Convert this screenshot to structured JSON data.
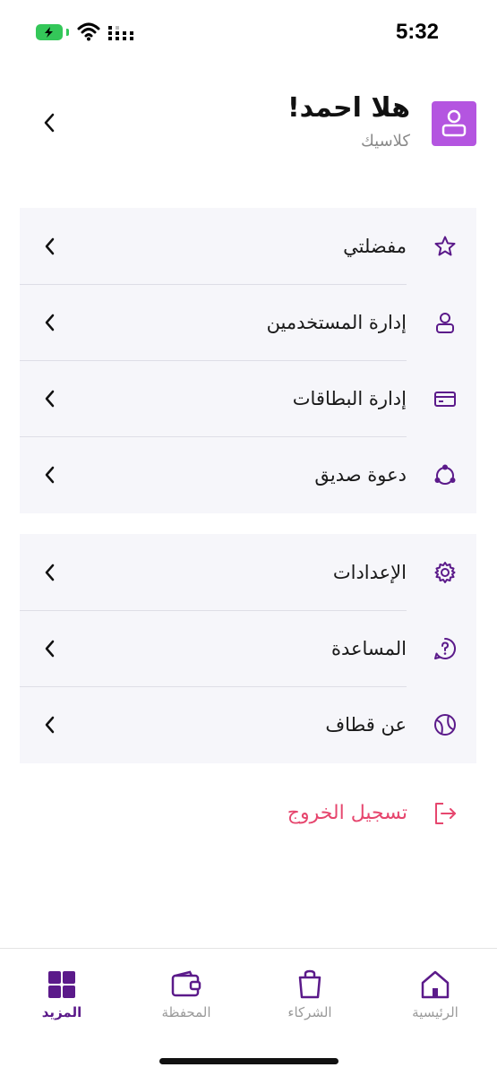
{
  "status_bar": {
    "time": "5:32"
  },
  "profile": {
    "greeting": "هلا احمد!",
    "plan": "كلاسيك"
  },
  "menu_group_1": [
    {
      "label": "مفضلتي",
      "icon": "star-icon"
    },
    {
      "label": "إدارة المستخدمين",
      "icon": "user-icon"
    },
    {
      "label": "إدارة البطاقات",
      "icon": "card-icon"
    },
    {
      "label": "دعوة صديق",
      "icon": "share-icon"
    }
  ],
  "menu_group_2": [
    {
      "label": "الإعدادات",
      "icon": "gear-icon"
    },
    {
      "label": "المساعدة",
      "icon": "help-icon"
    },
    {
      "label": "عن قطاف",
      "icon": "globe-icon"
    }
  ],
  "logout": {
    "label": "تسجيل الخروج",
    "color": "#e6466e"
  },
  "tabs": [
    {
      "label": "الرئيسية",
      "icon": "home-icon"
    },
    {
      "label": "الشركاء",
      "icon": "bag-icon"
    },
    {
      "label": "المحفظة",
      "icon": "wallet-icon"
    },
    {
      "label": "المزيد",
      "icon": "grid-icon",
      "active": true
    }
  ],
  "colors": {
    "accent": "#5b1a8a",
    "avatar": "#b455e0",
    "card_bg": "#f6f6fa"
  }
}
